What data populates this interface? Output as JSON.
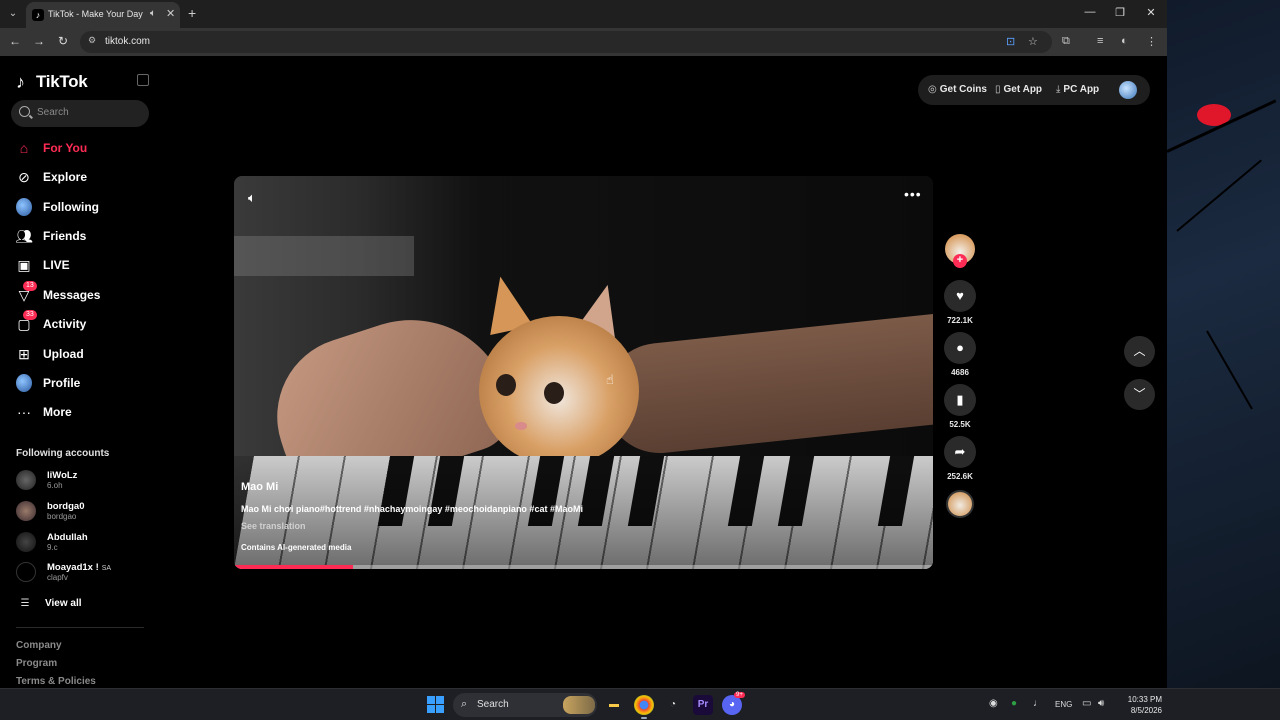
{
  "browser": {
    "tab_title": "TikTok - Make Your Day",
    "url": "tiktok.com"
  },
  "sidebar": {
    "brand": "TikTok",
    "search_placeholder": "Search",
    "nav": [
      {
        "label": "For You",
        "icon": "home-icon",
        "active": true
      },
      {
        "label": "Explore",
        "icon": "compass-icon"
      },
      {
        "label": "Following",
        "icon": "following-avatar-icon"
      },
      {
        "label": "Friends",
        "icon": "friends-icon"
      },
      {
        "label": "LIVE",
        "icon": "live-icon"
      },
      {
        "label": "Messages",
        "icon": "messages-icon",
        "badge": "13"
      },
      {
        "label": "Activity",
        "icon": "activity-icon",
        "badge": "33"
      },
      {
        "label": "Upload",
        "icon": "upload-icon"
      },
      {
        "label": "Profile",
        "icon": "profile-avatar-icon"
      },
      {
        "label": "More",
        "icon": "more-icon"
      }
    ],
    "following_title": "Following accounts",
    "accounts": [
      {
        "name": "liWoLz",
        "sub": "6.oh"
      },
      {
        "name": "bordga0",
        "sub": "bordgao"
      },
      {
        "name": "Abdullah",
        "sub": "9.c"
      },
      {
        "name": "Moayad1x !",
        "tag": "SA",
        "sub": "clapfv"
      }
    ],
    "view_all": "View all",
    "footer": [
      "Company",
      "Program",
      "Terms & Policies"
    ]
  },
  "topbar": {
    "get_coins": "Get Coins",
    "get_app": "Get App",
    "pc_app": "PC App"
  },
  "video": {
    "author": "Mao Mi",
    "caption": "Mao Mi chơi piano#hottrend #nhachaymoingay #meochoidanpiano #cat #MaoMi",
    "see_translation": "See translation",
    "ai_label": "Contains AI-generated media",
    "progress": 0.17
  },
  "actions": {
    "likes": "722.1K",
    "comments": "4686",
    "saves": "52.5K",
    "shares": "252.6K"
  },
  "taskbar": {
    "search": "Search",
    "lang": "ENG",
    "time": "10:33 PM",
    "date": "8/5/2026",
    "discord_badge": "9+"
  },
  "colors": {
    "accent": "#fe2c55",
    "background": "#000000"
  }
}
